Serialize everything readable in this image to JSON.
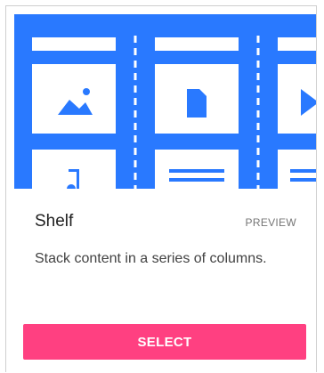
{
  "card": {
    "title": "Shelf",
    "badge": "PREVIEW",
    "description": "Stack content in a series of columns.",
    "select_label": "SELECT"
  },
  "thumbnail": {
    "icons": [
      "image-icon",
      "document-icon",
      "play-icon",
      "music-note-icon"
    ]
  },
  "colors": {
    "thumbnail_bg": "#2979ff",
    "accent": "#ff4081",
    "tile": "#ffffff"
  }
}
